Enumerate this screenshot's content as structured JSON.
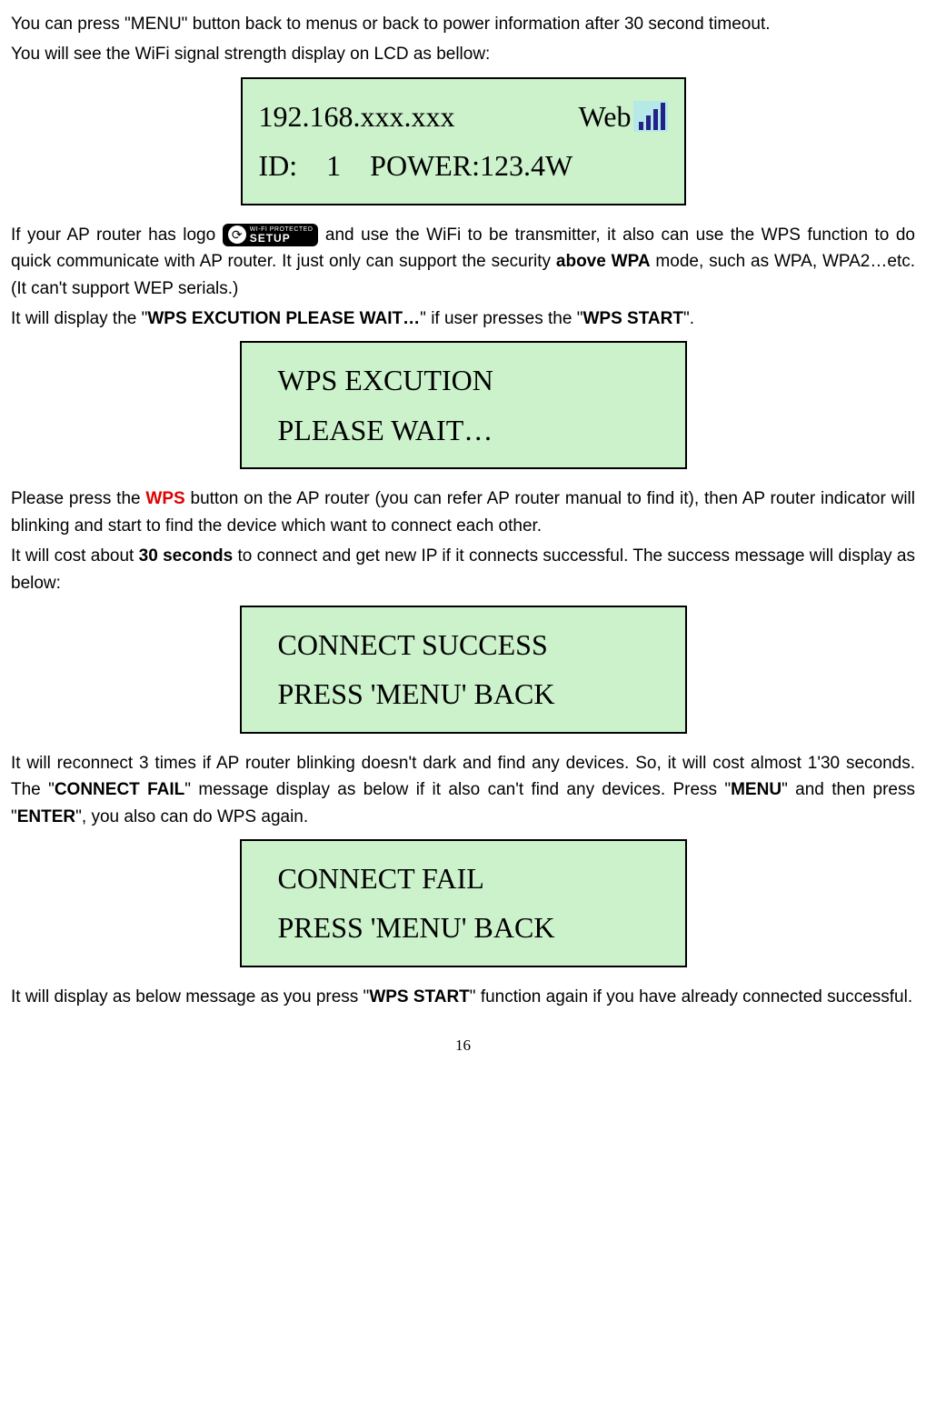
{
  "para1a": "You can press \"MENU\" button back to menus or back to power information after 30 second timeout.",
  "para1b": "You will see the WiFi signal strength display on LCD as bellow:",
  "lcd1": {
    "ip": "192.168.xxx.xxx",
    "web": "Web",
    "line2": "ID:    1    POWER:123.4W"
  },
  "para2a": "If your AP router has logo ",
  "para2b": " and use the WiFi to be transmitter, it also can use the WPS function to do quick communicate with AP router. It just only can support the security ",
  "para2c": "above WPA",
  "para2d": " mode, such as WPA, WPA2…etc. (It can't support WEP serials.)",
  "para3a": "It will display the \"",
  "para3b": "WPS EXCUTION PLEASE WAIT…",
  "para3c": "\" if user presses the \"",
  "para3d": "WPS START",
  "para3e": "\".",
  "lcd2": {
    "line1": "WPS EXCUTION",
    "line2": "PLEASE WAIT…"
  },
  "para4a": "Please press the ",
  "para4b": "WPS",
  "para4c": " button on the AP router (you can refer AP router manual to find it), then AP router indicator will blinking and start to find the device which want to connect each other.",
  "para5a": "It will cost about ",
  "para5b": "30 seconds",
  "para5c": " to connect and get new IP if it connects successful. The success message will display as below:",
  "lcd3": {
    "line1": "CONNECT SUCCESS",
    "line2": "PRESS 'MENU' BACK"
  },
  "para6a": "It will reconnect 3 times if AP router blinking doesn't dark and find any devices. So, it will cost almost 1'30 seconds. The \"",
  "para6b": "CONNECT FAIL",
  "para6c": "\" message display as below if it also can't find any devices. Press \"",
  "para6d": "MENU",
  "para6e": "\" and then press \"",
  "para6f": "ENTER",
  "para6g": "\", you also can do WPS again.",
  "lcd4": {
    "line1": "CONNECT FAIL",
    "line2": "PRESS 'MENU' BACK"
  },
  "para7a": "It will display as below message as you press \"",
  "para7b": "WPS START",
  "para7c": "\" function again if you have already connected successful.",
  "wps_small": "WI-FI PROTECTED",
  "wps_big": "SETUP",
  "page": "16"
}
